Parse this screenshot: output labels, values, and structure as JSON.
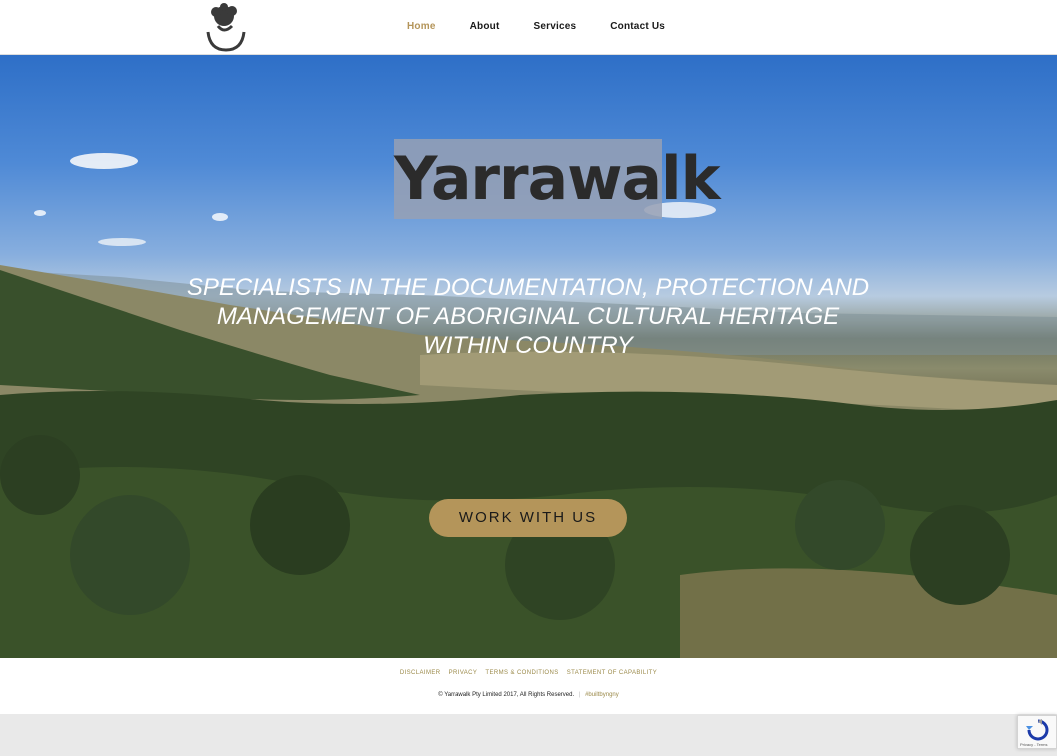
{
  "nav": {
    "items": [
      {
        "label": "Home",
        "active": true
      },
      {
        "label": "About",
        "active": false
      },
      {
        "label": "Services",
        "active": false
      },
      {
        "label": "Contact Us",
        "active": false
      }
    ]
  },
  "hero": {
    "title": "Yarrawalk",
    "tagline": "SPECIALISTS IN THE DOCUMENTATION, PROTECTION AND MANAGEMENT OF ABORIGINAL CULTURAL HERITAGE WITHIN COUNTRY",
    "cta_label": "WORK WITH US"
  },
  "footer": {
    "links": [
      "DISCLAIMER",
      "PRIVACY",
      "TERMS & CONDITIONS",
      "STATEMENT OF CAPABILITY"
    ],
    "copyright": "© Yarrawalk Pty Limited 2017, All Rights Reserved.",
    "separator": "|",
    "credit": "#builtbyngny"
  },
  "recaptcha": {
    "text": "Privacy - Terms"
  },
  "colors": {
    "accent": "#b4955a",
    "header_bg": "#ffffff",
    "title_box": "#96a0b4"
  },
  "icons": [
    "logo-icon",
    "recaptcha-icon"
  ]
}
